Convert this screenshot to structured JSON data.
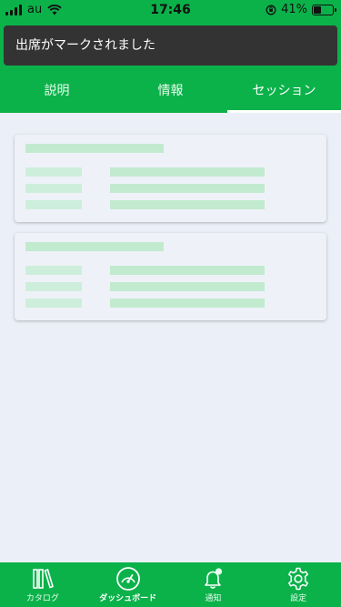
{
  "status_bar": {
    "carrier": "au",
    "time": "17:46",
    "battery_percent": "41%",
    "battery_level": 0.41
  },
  "toast": {
    "message": "出席がマークされました"
  },
  "tabs": [
    {
      "label": "説明",
      "active": false
    },
    {
      "label": "情報",
      "active": false
    },
    {
      "label": "セッション",
      "active": true
    }
  ],
  "loading_cards": {
    "count": 2,
    "state": "skeleton-loading"
  },
  "bottom_nav": [
    {
      "label": "カタログ",
      "icon": "books-icon",
      "active": false
    },
    {
      "label": "ダッシュボード",
      "icon": "gauge-icon",
      "active": true
    },
    {
      "label": "通知",
      "icon": "bell-icon",
      "active": false,
      "badge": true
    },
    {
      "label": "設定",
      "icon": "gear-icon",
      "active": false
    }
  ],
  "colors": {
    "primary": "#0bb24a",
    "toast_bg": "#333333",
    "background": "#ebeff7",
    "skeleton": "#c2eacf"
  }
}
